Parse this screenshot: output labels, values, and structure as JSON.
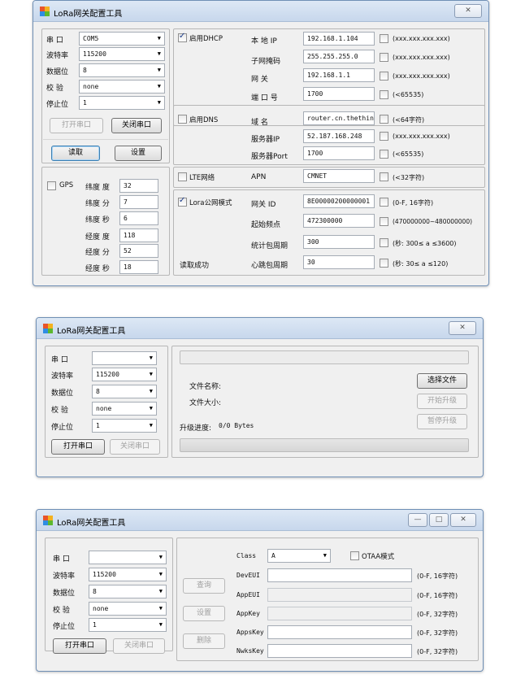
{
  "app_title": "LoRa网关配置工具",
  "window_controls": {
    "close": "✕",
    "minimize": "—",
    "maximize": "□"
  },
  "serial": {
    "port_label": "串 口",
    "baud_label": "波特率",
    "data_bits_label": "数据位",
    "parity_label": "校 验",
    "stop_bits_label": "停止位",
    "open_button": "打开串口",
    "close_button": "关闭串口"
  },
  "win1": {
    "port_value": "COM5",
    "baud_value": "115200",
    "data_bits_value": "8",
    "parity_value": "none",
    "stop_bits_value": "1",
    "read_button": "读取",
    "set_button": "设置",
    "gps": {
      "label": "GPS",
      "lat_deg_label": "纬度 度",
      "lat_deg": "32",
      "lat_min_label": "纬度 分",
      "lat_min": "7",
      "lat_sec_label": "纬度 秒",
      "lat_sec": "6",
      "lon_deg_label": "经度 度",
      "lon_deg": "118",
      "lon_min_label": "经度 分",
      "lon_min": "52",
      "lon_sec_label": "经度 秒",
      "lon_sec": "18"
    },
    "dhcp": {
      "label": "启用DHCP",
      "local_ip_label": "本 地 IP",
      "local_ip": "192.168.1.104",
      "local_ip_hint": "(xxx.xxx.xxx.xxx)",
      "subnet_label": "子网掩码",
      "subnet": "255.255.255.0",
      "subnet_hint": "(xxx.xxx.xxx.xxx)",
      "gateway_label": "网 关",
      "gateway": "192.168.1.1",
      "gateway_hint": "(xxx.xxx.xxx.xxx)",
      "port_label": "端 口 号",
      "port": "1700",
      "port_hint": "(<65535)"
    },
    "dns": {
      "label": "启用DNS",
      "domain_label": "域 名",
      "domain": "router.cn.thethin",
      "domain_hint": "(<64字符)",
      "server_ip_label": "服务器IP",
      "server_ip": "52.187.168.248",
      "server_ip_hint": "(xxx.xxx.xxx.xxx)",
      "server_port_label": "服务器Port",
      "server_port": "1700",
      "server_port_hint": "(<65535)"
    },
    "lte": {
      "label": "LTE网络",
      "apn_label": "APN",
      "apn": "CMNET",
      "apn_hint": "(<32字符)"
    },
    "lora": {
      "label": "Lora公网模式",
      "gateway_id_label": "网关 ID",
      "gateway_id": "8E00000200000001",
      "gateway_id_hint": "(0-F, 16字符)",
      "start_freq_label": "起始频点",
      "start_freq": "472300000",
      "start_freq_hint": "(470000000~480000000)",
      "stat_period_label": "统计包周期",
      "stat_period": "300",
      "stat_period_hint": "(秒: 300≤ a ≤3600)",
      "heartbeat_label": "心跳包周期",
      "heartbeat": "30",
      "heartbeat_hint": "(秒: 30≤ a ≤120)"
    },
    "status": "读取成功"
  },
  "win2": {
    "baud_value": "115200",
    "data_bits_value": "8",
    "parity_value": "none",
    "stop_bits_value": "1",
    "file_name_label": "文件名称:",
    "file_size_label": "文件大小:",
    "select_file_button": "选择文件",
    "start_upgrade_button": "开始升级",
    "pause_upgrade_button": "暂停升级",
    "progress_label": "升级进度:",
    "progress_value": "0/0 Bytes",
    "progress_fraction": 0
  },
  "win3": {
    "baud_value": "115200",
    "data_bits_value": "8",
    "parity_value": "none",
    "stop_bits_value": "1",
    "query_button": "查询",
    "set_button": "设置",
    "delete_button": "删除",
    "class_label": "Class",
    "class_value": "A",
    "otaa_label": "OTAA模式",
    "deveui_label": "DevEUI",
    "deveui_hint": "(0-F, 16字符)",
    "appeui_label": "AppEUI",
    "appeui_hint": "(0-F, 16字符)",
    "appkey_label": "AppKey",
    "appkey_hint": "(0-F, 32字符)",
    "appskey_label": "AppsKey",
    "appskey_hint": "(0-F, 32字符)",
    "nwkskey_label": "NwksKey",
    "nwkskey_hint": "(0-F, 32字符)"
  }
}
